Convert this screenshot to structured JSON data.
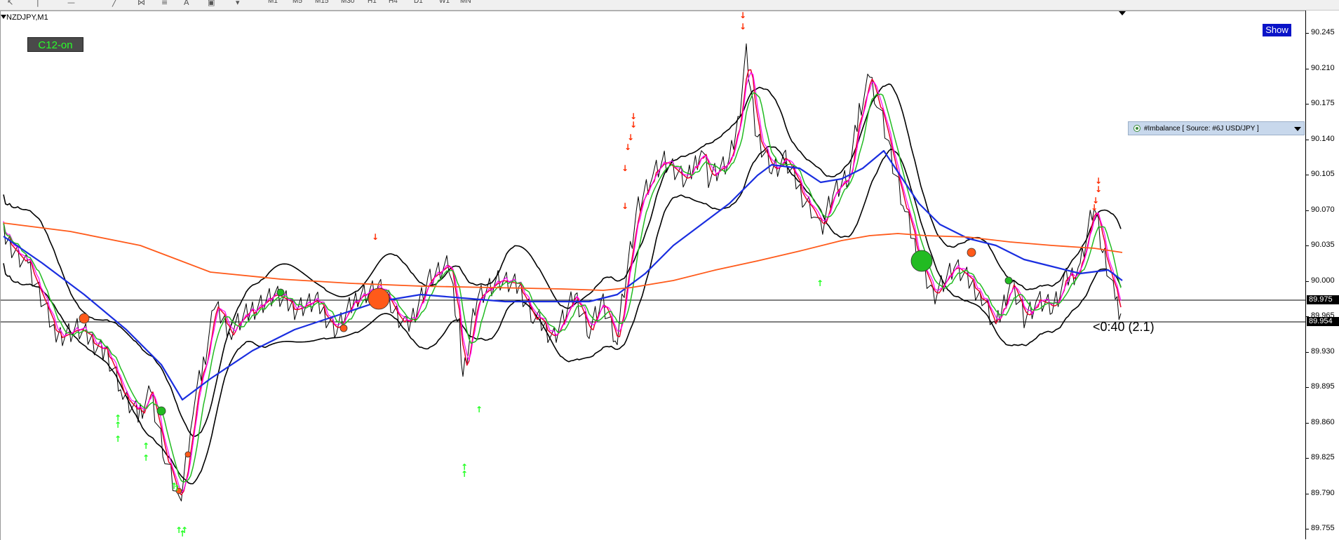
{
  "toolbar": {
    "timeframes": [
      "M1",
      "M5",
      "M15",
      "M30",
      "H1",
      "H4",
      "D1",
      "W1",
      "MN"
    ]
  },
  "chart": {
    "symbol": "NZDJPY,M1",
    "c12_label": "C12-on",
    "show_label": "Show",
    "imbalance_label": "#Imbalance [ Source: #6J USD/JPY ]",
    "timer_label": "<0:40 (2.1)",
    "price_axis": {
      "ticks": [
        "90.245",
        "90.210",
        "90.175",
        "90.140",
        "90.105",
        "90.070",
        "90.035",
        "90.000",
        "89.965",
        "89.930",
        "89.895",
        "89.860",
        "89.825",
        "89.790",
        "89.755"
      ],
      "tag_upper": "89.975",
      "tag_lower": "89.954"
    },
    "colors": {
      "price_line": "#000000",
      "ma_fast_red": "#e8002a",
      "ma_magenta": "#ff00ff",
      "ma_green": "#22bb22",
      "ma_blue": "#1a2ee0",
      "ma_orange": "#ff5a1a",
      "envelope": "#000000",
      "buy_arrow": "#22ff22",
      "sell_arrow": "#ff2a00",
      "imbalance_panel": "#c8d8ec",
      "show_button": "#0a14c8",
      "c12_text": "#29ff29"
    }
  }
}
